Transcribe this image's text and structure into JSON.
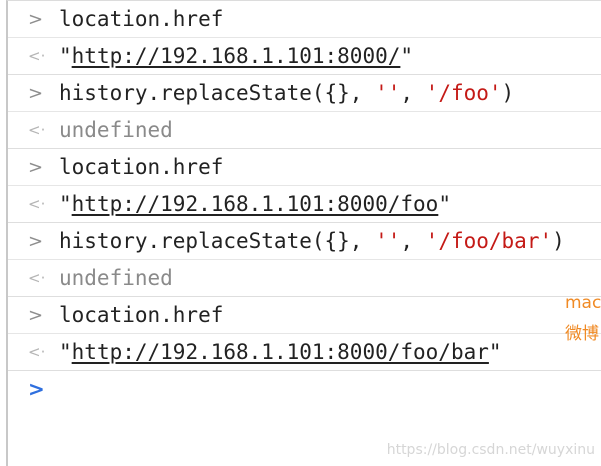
{
  "console": {
    "entries": [
      {
        "kind": "input",
        "text": "location.href"
      },
      {
        "kind": "output",
        "prefix": "\"",
        "url": "http://192.168.1.101:8000/",
        "suffix": "\""
      },
      {
        "kind": "input",
        "pre": "history.replaceState({}, ",
        "arg1": "''",
        "mid": ", ",
        "arg2": "'/foo'",
        "post": ")"
      },
      {
        "kind": "output",
        "text": "undefined"
      },
      {
        "kind": "input",
        "text": "location.href"
      },
      {
        "kind": "output",
        "prefix": "\"",
        "url": "http://192.168.1.101:8000/foo",
        "suffix": "\""
      },
      {
        "kind": "input",
        "pre": "history.replaceState({}, ",
        "arg1": "''",
        "mid": ", ",
        "arg2": "'/foo/bar'",
        "post": ")"
      },
      {
        "kind": "output",
        "text": "undefined"
      },
      {
        "kind": "input",
        "text": "location.href"
      },
      {
        "kind": "output",
        "prefix": "\"",
        "url": "http://192.168.1.101:8000/foo/bar",
        "suffix": "\""
      }
    ],
    "icons": {
      "input_prompt": "chevron-right-icon",
      "output_prompt": "return-arrow-icon",
      "active_prompt": "chevron-right-icon"
    },
    "prompt_glyphs": {
      "input": ">",
      "output": "<·",
      "active": ">"
    }
  },
  "side_note": {
    "line1": "mac",
    "line2": "微博"
  },
  "watermark": "https://blog.csdn.net/wuyxinu",
  "colors": {
    "string_literal": "#c41a16",
    "active_prompt": "#2f6fde",
    "side_note": "#f08a24"
  }
}
